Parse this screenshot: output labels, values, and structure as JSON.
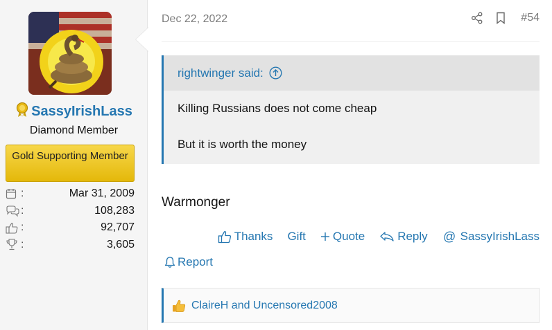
{
  "user": {
    "username": "SassyIrishLass",
    "title": "Diamond Member",
    "banner": "Gold Supporting Member",
    "stats": [
      {
        "icon": "calendar-icon",
        "value": "Mar 31, 2009"
      },
      {
        "icon": "messages-icon",
        "value": "108,283"
      },
      {
        "icon": "reactions-thumb-icon",
        "value": "92,707"
      },
      {
        "icon": "trophy-icon",
        "value": "3,605"
      }
    ],
    "stat_colon": ":"
  },
  "post": {
    "date": "Dec 22, 2022",
    "number": "#54",
    "quote": {
      "author_line": "rightwinger said:",
      "lines": [
        "Killing Russians does not come cheap",
        "But it is worth the money"
      ]
    },
    "body": "Warmonger",
    "actions": {
      "thanks": "Thanks",
      "gift": "Gift",
      "quote": "Quote",
      "reply": "Reply",
      "mention": "SassyIrishLass",
      "report": "Report"
    },
    "reactions_text": "ClaireH and Uncensored2008"
  },
  "colors": {
    "link": "#2577b1",
    "banner": "#e4b80a",
    "quote_bg": "#f0f0f0"
  }
}
